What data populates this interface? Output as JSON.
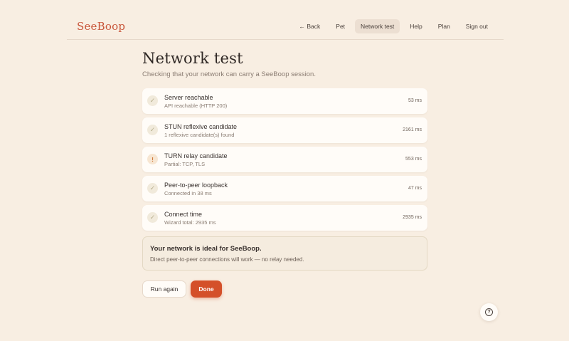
{
  "app": {
    "logo": "SeeBoop"
  },
  "nav": {
    "back": "← Back",
    "items": [
      "Pet",
      "Network test",
      "Help",
      "Plan",
      "Sign out"
    ],
    "active": "Network test"
  },
  "page": {
    "title": "Network test",
    "subtitle": "Checking that your network can carry a SeeBoop session."
  },
  "checks": [
    {
      "name": "Server reachable",
      "detail": "API reachable (HTTP 200)",
      "time": "53 ms",
      "status": "ok",
      "icon": "check-icon"
    },
    {
      "name": "STUN reflexive candidate",
      "detail": "1 reflexive candidate(s) found",
      "time": "2161 ms",
      "status": "ok",
      "icon": "check-icon"
    },
    {
      "name": "TURN relay candidate",
      "detail": "Partial: TCP, TLS",
      "time": "553 ms",
      "status": "warning",
      "icon": "exclamation-icon"
    },
    {
      "name": "Peer-to-peer loopback",
      "detail": "Connected in 38 ms",
      "time": "47 ms",
      "status": "ok",
      "icon": "check-icon"
    },
    {
      "name": "Connect time",
      "detail": "Wizard total: 2935 ms",
      "time": "2935 ms",
      "status": "ok",
      "icon": "check-icon"
    }
  ],
  "verdict": {
    "title": "Your network is ideal for SeeBoop.",
    "text": "Direct peer-to-peer connections will work — no relay needed."
  },
  "actions": {
    "run_again": "Run again",
    "done": "Done"
  },
  "icons": {
    "check": "✓",
    "warning": "!",
    "help": "?"
  },
  "colors": {
    "accent": "#d4502a",
    "logo": "#c8553a",
    "background": "#f8eee2"
  }
}
